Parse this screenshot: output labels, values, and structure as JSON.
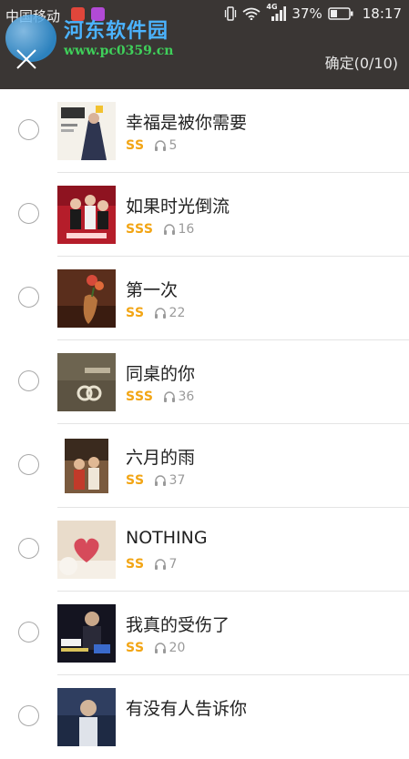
{
  "status_bar": {
    "carrier": "中国移动",
    "network": "4G",
    "battery": "37%",
    "time": "18:17"
  },
  "watermark": {
    "title": "河东软件园",
    "url": "www.pc0359.cn"
  },
  "header": {
    "confirm_label": "确定(0/10)"
  },
  "colors": {
    "header_bg": "#3a3634",
    "quality": "#f2a515"
  },
  "songs": [
    {
      "title": "幸福是被你需要",
      "quality": "SS",
      "plays": "5"
    },
    {
      "title": "如果时光倒流",
      "quality": "SSS",
      "plays": "16"
    },
    {
      "title": "第一次",
      "quality": "SS",
      "plays": "22"
    },
    {
      "title": "同桌的你",
      "quality": "SSS",
      "plays": "36"
    },
    {
      "title": "六月的雨",
      "quality": "SS",
      "plays": "37"
    },
    {
      "title": "NOTHING",
      "quality": "SS",
      "plays": "7"
    },
    {
      "title": "我真的受伤了",
      "quality": "SS",
      "plays": "20"
    },
    {
      "title": "有没有人告诉你",
      "quality": "",
      "plays": ""
    }
  ]
}
